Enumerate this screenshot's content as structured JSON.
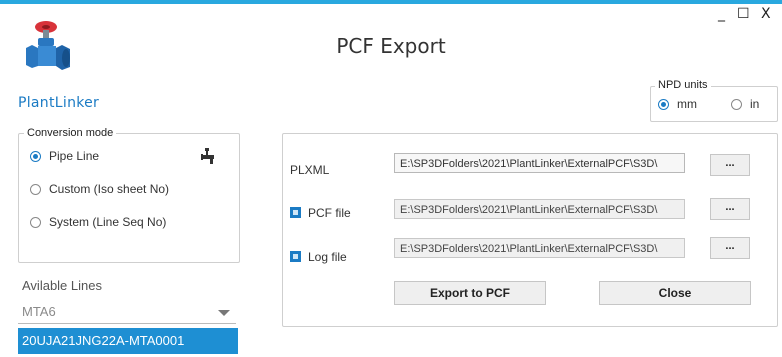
{
  "window": {
    "minimize": "_",
    "maximize": "☐",
    "close": "X",
    "title": "PCF Export"
  },
  "app": {
    "name": "PlantLinker",
    "logo_icon": "valve-icon"
  },
  "conversion_mode": {
    "legend": "Conversion mode",
    "options": [
      {
        "label": "Pipe Line",
        "selected": true
      },
      {
        "label": "Custom (Iso sheet No)",
        "selected": false
      },
      {
        "label": "System (Line Seq No)",
        "selected": false
      }
    ],
    "icon": "pipe-fitting-icon"
  },
  "npd_units": {
    "legend": "NPD units",
    "options": [
      {
        "label": "mm",
        "selected": true
      },
      {
        "label": "in",
        "selected": false
      }
    ]
  },
  "lines": {
    "label": "Avilable Lines",
    "selected": "MTA6",
    "dropdown_option": "20UJA21JNG22A-MTA0001"
  },
  "files": {
    "plxml": {
      "label": "PLXML",
      "path": "E:\\SP3DFolders\\2021\\PlantLinker\\ExternalPCF\\S3D\\",
      "browse": "..."
    },
    "pcf": {
      "label": "PCF file",
      "checked": true,
      "path": "E:\\SP3DFolders\\2021\\PlantLinker\\ExternalPCF\\S3D\\",
      "browse": "..."
    },
    "log": {
      "label": "Log file",
      "checked": true,
      "path": "E:\\SP3DFolders\\2021\\PlantLinker\\ExternalPCF\\S3D\\",
      "browse": "..."
    }
  },
  "actions": {
    "export": "Export to PCF",
    "close": "Close"
  },
  "colors": {
    "accent": "#1b7bc4",
    "topline": "#29a8df",
    "selection": "#1e8fd3"
  }
}
